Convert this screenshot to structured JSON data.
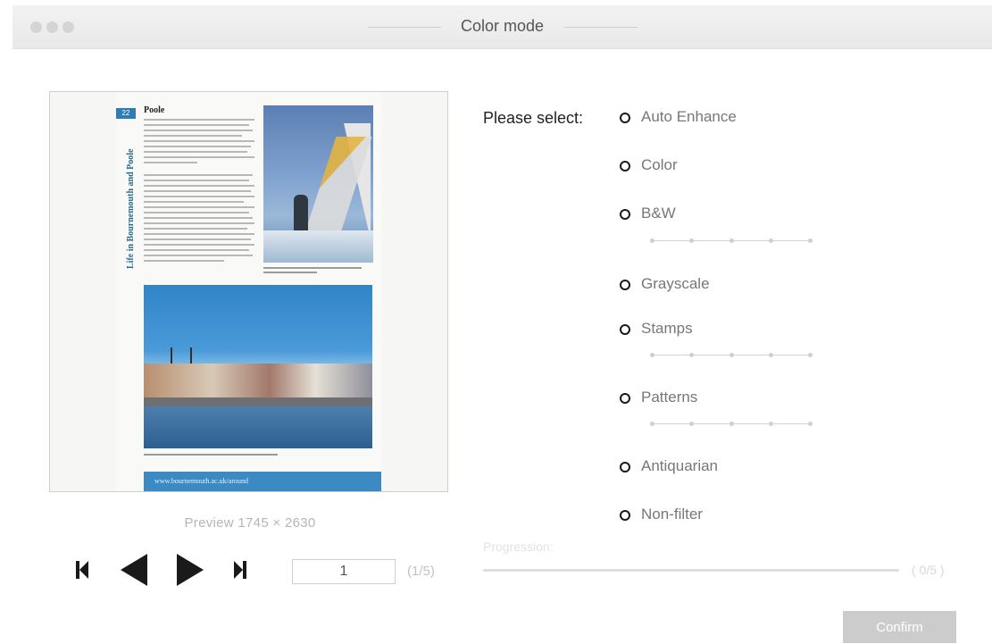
{
  "window": {
    "title": "Color mode",
    "traffic_lights": [
      "close",
      "minimize",
      "zoom"
    ]
  },
  "preview": {
    "label": "Preview  1745 × 2630",
    "document": {
      "page_number": "22",
      "side_title": "Life in Bournemouth and Poole",
      "heading": "Poole",
      "footer": "www.bournemouth.ac.uk/around"
    }
  },
  "navigation": {
    "first_icon": "skip-to-first-icon",
    "prev_icon": "previous-triangle-icon",
    "next_icon": "next-triangle-icon",
    "last_icon": "skip-to-last-icon",
    "page_value": "1",
    "page_count": "(1/5)"
  },
  "options": {
    "prompt": "Please select:",
    "items": [
      {
        "label": "Auto Enhance",
        "has_slider": false
      },
      {
        "label": "Color",
        "has_slider": false
      },
      {
        "label": "B&W",
        "has_slider": true
      },
      {
        "label": "Grayscale",
        "has_slider": false
      },
      {
        "label": "Stamps",
        "has_slider": true
      },
      {
        "label": "Patterns",
        "has_slider": true
      },
      {
        "label": "Antiquarian",
        "has_slider": false
      },
      {
        "label": "Non-filter",
        "has_slider": false
      }
    ]
  },
  "progress": {
    "label": "Progression:",
    "count": "( 0/5 )",
    "fraction": 0
  },
  "actions": {
    "confirm_label": "Confirm"
  },
  "colors": {
    "accent_blue": "#2f7db3",
    "confirm_bg": "#cccccc",
    "radio": "#1a1a1a"
  }
}
